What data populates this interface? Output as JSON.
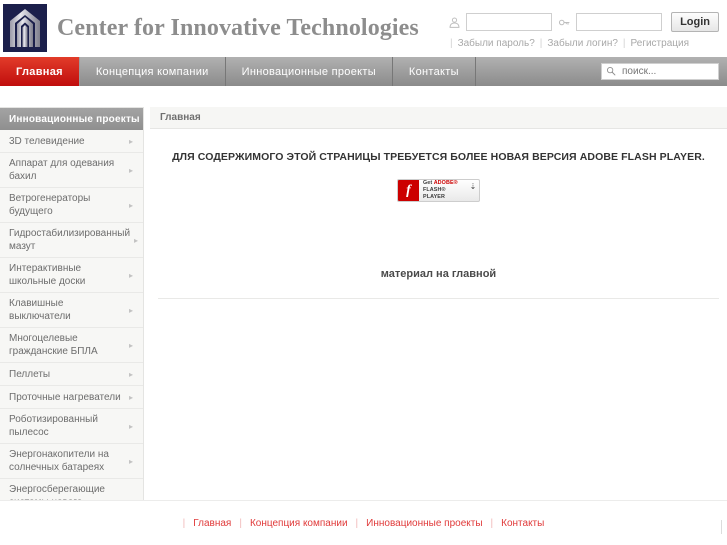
{
  "header": {
    "site_title": "Center for Innovative Technologies",
    "logo_icon": "building-arch-logo-icon",
    "login": {
      "user_icon": "user-icon",
      "key_icon": "key-icon",
      "username_value": "",
      "username_placeholder": "",
      "password_value": "",
      "password_placeholder": "",
      "login_button": "Login",
      "links": [
        "Забыли пароль?",
        "Забыли логин?",
        "Регистрация"
      ],
      "separator": "|"
    }
  },
  "nav": {
    "items": [
      {
        "label": "Главная",
        "active": true
      },
      {
        "label": "Концепция компании",
        "active": false
      },
      {
        "label": "Инновационные проекты",
        "active": false
      },
      {
        "label": "Контакты",
        "active": false
      }
    ],
    "search": {
      "icon": "search-icon",
      "placeholder": "поиск...",
      "value": ""
    },
    "active_color": "#c00d0d",
    "bar_color": "#9a9a9a"
  },
  "sidebar": {
    "title": "Инновационные проекты",
    "arrow_glyph": "▸",
    "items": [
      {
        "label": "3D телевидение"
      },
      {
        "label": "Аппарат для одевания бахил"
      },
      {
        "label": "Ветрогенераторы будущего"
      },
      {
        "label": "Гидростабилизированный мазут"
      },
      {
        "label": "Интерактивные школьные доски"
      },
      {
        "label": "Клавишные выключатели"
      },
      {
        "label": "Многоцелевые гражданские БПЛА"
      },
      {
        "label": "Пеллеты"
      },
      {
        "label": "Проточные нагреватели"
      },
      {
        "label": "Роботизированный пылесос"
      },
      {
        "label": "Энергонакопители на солнечных батареях"
      },
      {
        "label": "Энергосберегающие системы нового поколения"
      }
    ]
  },
  "content": {
    "breadcrumb": "Главная",
    "flash_notice": "ДЛЯ СОДЕРЖИМОГО ЭТОЙ СТРАНИЦЫ ТРЕБУЕТСЯ БОЛЕЕ НОВАЯ ВЕРСИЯ ADOBE FLASH PLAYER.",
    "flash_badge": {
      "logo_glyph": "f",
      "line1_get": "Get ",
      "line1_adobe": "ADOBE®",
      "line2": "FLASH® PLAYER",
      "download_icon": "download-arrow-icon",
      "accent_color": "#cc0000"
    },
    "main_material": "материал на главной"
  },
  "footer": {
    "links": [
      "Главная",
      "Концепция компании",
      "Инновационные проекты",
      "Контакты"
    ],
    "separator": "|",
    "link_color": "#e03a3a"
  }
}
